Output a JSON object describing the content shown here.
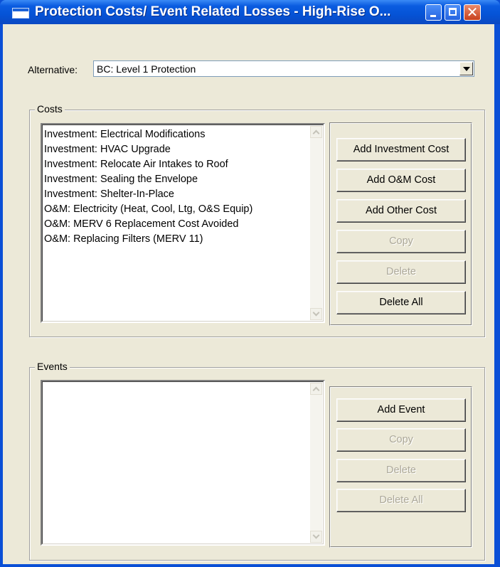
{
  "window": {
    "title": "Protection Costs/ Event Related Losses - High-Rise O..."
  },
  "alternative": {
    "label": "Alternative:",
    "value": "BC: Level 1 Protection"
  },
  "costs": {
    "group_label": "Costs",
    "items": [
      "Investment: Electrical Modifications",
      "Investment: HVAC Upgrade",
      "Investment: Relocate Air Intakes to Roof",
      "Investment: Sealing the Envelope",
      "Investment: Shelter-In-Place",
      "O&M: Electricity (Heat, Cool, Ltg, O&S Equip)",
      "O&M: MERV 6 Replacement Cost Avoided",
      "O&M: Replacing Filters (MERV 11)"
    ],
    "buttons": {
      "add_investment": "Add Investment Cost",
      "add_om": "Add O&M Cost",
      "add_other": "Add Other Cost",
      "copy": "Copy",
      "delete": "Delete",
      "delete_all": "Delete All"
    }
  },
  "events": {
    "group_label": "Events",
    "items": [],
    "buttons": {
      "add_event": "Add Event",
      "copy": "Copy",
      "delete": "Delete",
      "delete_all": "Delete All"
    }
  },
  "icons": {
    "app": "window-icon",
    "minimize": "minimize-icon",
    "maximize": "maximize-icon",
    "close": "close-icon",
    "dropdown": "chevron-down-icon",
    "scroll_up": "chevron-up-icon",
    "scroll_down": "chevron-down-icon"
  },
  "colors": {
    "titlebar": "#0553d6",
    "client": "#ece9d8",
    "close_button": "#c8401c",
    "disabled_text": "#aca899"
  }
}
